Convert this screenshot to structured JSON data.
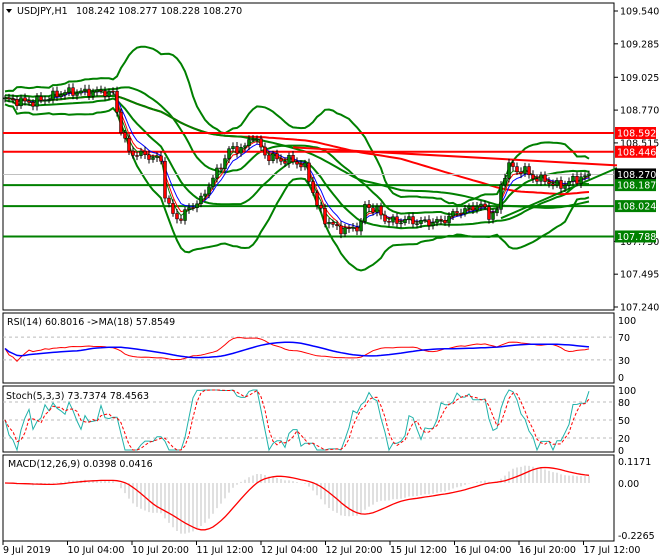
{
  "header": {
    "symbol": "USDJPY,H1",
    "ohlc": "108.242 108.277 108.228 108.270"
  },
  "colors": {
    "bull": "#008000",
    "bear": "#ff0000",
    "band": "#008000",
    "support": "#008000",
    "resistance": "#ff0000",
    "ma_fast": "#0000ff",
    "ma_mid": "#ff0000",
    "ma_slow": "#008000",
    "rsi": "#ff0000",
    "rsi_ma": "#0000ff",
    "stoch_main": "#20b2aa",
    "stoch_signal": "#ff0000",
    "macd_hist": "#c0c0c0",
    "macd_signal": "#ff0000",
    "current": "#000000"
  },
  "chart_data": [
    {
      "type": "candlestick",
      "title": "USDJPY,H1",
      "ylim": [
        107.24,
        109.54
      ],
      "y_ticks": [
        "109.540",
        "109.285",
        "109.025",
        "108.770",
        "108.515",
        "107.750",
        "107.495",
        "107.240"
      ],
      "x_ticks": [
        "9 Jul 2019",
        "10 Jul 04:00",
        "10 Jul 20:00",
        "11 Jul 12:00",
        "12 Jul 04:00",
        "12 Jul 20:00",
        "15 Jul 12:00",
        "16 Jul 04:00",
        "16 Jul 20:00",
        "17 Jul 12:00"
      ],
      "close_by_hour": [
        [
          0,
          108.85
        ],
        [
          7,
          108.83
        ],
        [
          15,
          108.91
        ],
        [
          25,
          108.91
        ],
        [
          27,
          108.9
        ],
        [
          29,
          108.62
        ],
        [
          31,
          108.44
        ],
        [
          35,
          108.42
        ],
        [
          39,
          108.38
        ],
        [
          40,
          108.11
        ],
        [
          42,
          107.95
        ],
        [
          44,
          107.93
        ],
        [
          46,
          108.01
        ],
        [
          49,
          108.07
        ],
        [
          51,
          108.19
        ],
        [
          54,
          108.34
        ],
        [
          56,
          108.46
        ],
        [
          60,
          108.48
        ],
        [
          62,
          108.58
        ],
        [
          65,
          108.42
        ],
        [
          69,
          108.38
        ],
        [
          72,
          108.38
        ],
        [
          75,
          108.32
        ],
        [
          76,
          108.24
        ],
        [
          78,
          108.03
        ],
        [
          80,
          107.92
        ],
        [
          83,
          107.85
        ],
        [
          86,
          107.84
        ],
        [
          89,
          107.88
        ],
        [
          90,
          108.03
        ],
        [
          93,
          107.99
        ],
        [
          95,
          107.92
        ],
        [
          98,
          107.9
        ],
        [
          100,
          107.92
        ],
        [
          103,
          107.9
        ],
        [
          108,
          107.9
        ],
        [
          110,
          107.92
        ],
        [
          113,
          107.98
        ],
        [
          115,
          107.99
        ],
        [
          118,
          108.03
        ],
        [
          120,
          108.01
        ],
        [
          121,
          107.95
        ],
        [
          123,
          107.98
        ],
        [
          124,
          108.19
        ],
        [
          125,
          108.27
        ],
        [
          126,
          108.34
        ],
        [
          128,
          108.3
        ],
        [
          130,
          108.3
        ],
        [
          131,
          108.27
        ],
        [
          133,
          108.23
        ],
        [
          135,
          108.23
        ],
        [
          137,
          108.19
        ],
        [
          140,
          108.19
        ],
        [
          142,
          108.23
        ],
        [
          145,
          108.25
        ],
        [
          147,
          108.27
        ]
      ],
      "levels": [
        {
          "label": "108.592",
          "value": 108.592,
          "kind": "resistance"
        },
        {
          "label": "108.446",
          "value": 108.446,
          "kind": "resistance"
        },
        {
          "label": "108.270",
          "value": 108.27,
          "kind": "current"
        },
        {
          "label": "108.187",
          "value": 108.187,
          "kind": "support"
        },
        {
          "label": "108.024",
          "value": 108.024,
          "kind": "support"
        },
        {
          "label": "107.788",
          "value": 107.788,
          "kind": "support"
        }
      ],
      "trendlines": [
        {
          "kind": "resistance",
          "from": [
            72,
            108.48
          ],
          "to": [
            153,
            108.34
          ]
        },
        {
          "kind": "support",
          "from": [
            124,
            107.93
          ],
          "to": [
            153,
            108.32
          ]
        }
      ]
    },
    {
      "type": "line",
      "title": "RSI(14) 60.8016  ->MA(18) 57.8549",
      "ylim": [
        0,
        100
      ],
      "y_ticks": [
        "100",
        "70",
        "30",
        "0"
      ],
      "levels": [
        70,
        30
      ]
    },
    {
      "type": "line",
      "title": "Stoch(5,3,3) 73.7374 78.4563",
      "ylim": [
        0,
        100
      ],
      "y_ticks": [
        "100",
        "80",
        "50",
        "20",
        "0"
      ],
      "levels": [
        80,
        50,
        20
      ]
    },
    {
      "type": "bar",
      "title": "MACD(12,26,9) 0.0398 0.0416",
      "ylim": [
        -0.2265,
        0.1171
      ],
      "y_ticks": [
        "0.1171",
        "0.00",
        "-0.2265"
      ]
    }
  ]
}
